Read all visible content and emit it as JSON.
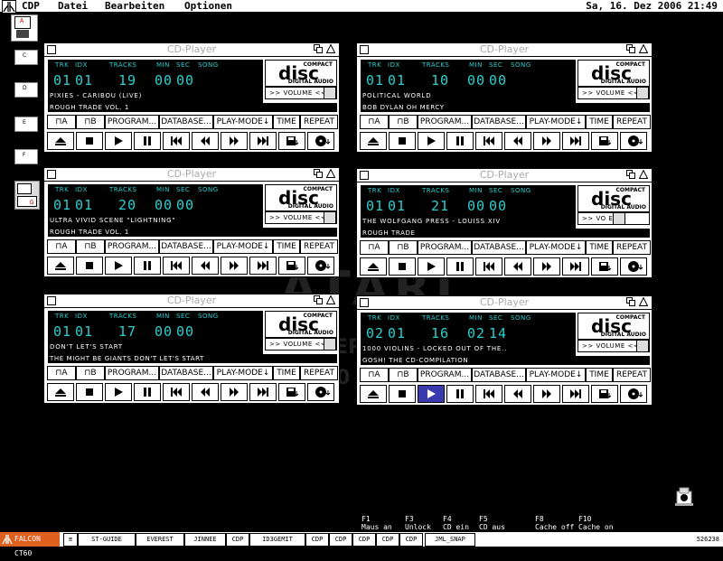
{
  "menubar": {
    "items": [
      "CDP",
      "Datei",
      "Bearbeiten",
      "Optionen"
    ],
    "clock": "Sa, 16. Dez 2006   21:49"
  },
  "desktop_icons": [
    "A",
    "C",
    "D",
    "E",
    "F",
    "G"
  ],
  "watermark": {
    "line1": "ATARI",
    "line2": "ER",
    "line3": "0"
  },
  "player_labels": {
    "title": "CD-Player",
    "hdr_trk": "TRK",
    "hdr_idx": "IDX",
    "hdr_tracks": "TRACKS",
    "hdr_min": "MIN",
    "hdr_sec": "SEC",
    "hdr_song": "SONG",
    "logo_top": "COMPACT",
    "logo_main": "disc",
    "logo_bottom": "DIGITAL AUDIO",
    "buttons": [
      "⊓A",
      "⊓B",
      "PROGRAM...",
      "DATABASE...",
      "PLAY-MODE↓",
      "TIME",
      "REPEAT"
    ]
  },
  "players": [
    {
      "trk": "01",
      "idx": "01",
      "tracks": "19",
      "min": "00",
      "sec": "00",
      "song": "PIXIES - CARIBOU (LIVE)",
      "album": "ROUGH TRADE VOL. 1",
      "volume": ">> VOLUME <<",
      "active": -1
    },
    {
      "trk": "01",
      "idx": "01",
      "tracks": "10",
      "min": "00",
      "sec": "00",
      "song": "POLITICAL WORLD",
      "album": "BOB DYLAN  OH MERCY",
      "volume": ">> VOLUME <<",
      "active": -1
    },
    {
      "trk": "01",
      "idx": "01",
      "tracks": "20",
      "min": "00",
      "sec": "00",
      "song": "ULTRA VIVID SCENE \"LIGHTNING\"",
      "album": "ROUGH TRADE  VOL. 1",
      "volume": ">> VOLUME <<",
      "active": -1
    },
    {
      "trk": "01",
      "idx": "01",
      "tracks": "21",
      "min": "00",
      "sec": "00",
      "song": "THE WOLFGANG PRESS - LOUISS XIV",
      "album": "ROUGH TRADE",
      "volume": ">> VO  E >>",
      "active": -1
    },
    {
      "trk": "01",
      "idx": "01",
      "tracks": "17",
      "min": "00",
      "sec": "00",
      "song": "DON'T LET'S START",
      "album": "THE MIGHT BE GIANTS  DON'T LET'S START",
      "volume": ">> VOLUME <<",
      "active": -1
    },
    {
      "trk": "02",
      "idx": "01",
      "tracks": "16",
      "min": "02",
      "sec": "14",
      "song": "1000 VIOLINS - LOCKED OUT OF THE..",
      "album": "GOSH! THE CD-COMPILATION",
      "volume": ">> VOLUME <<",
      "active": 2
    }
  ],
  "fhints": [
    {
      "key": "F1",
      "text": "Maus an"
    },
    {
      "key": "F3",
      "text": "Unlock"
    },
    {
      "key": "F4",
      "text": "CD ein"
    },
    {
      "key": "F5",
      "text": "CD aus"
    },
    {
      "key": "F8",
      "text": "Cache off"
    },
    {
      "key": "F10",
      "text": "Cache on"
    }
  ],
  "taskbar": {
    "start": "FALCON CT60",
    "items": [
      "≡",
      "ST-GUIDE",
      "EVEREST",
      "JINNEE",
      "CDP",
      "ID3GEMIT",
      "CDP",
      "CDP",
      "CDP",
      "CDP",
      "CDP",
      "JML_SNAP"
    ],
    "memory": "526238"
  },
  "colors": {
    "lcd": "#2ad0d0",
    "active_play": "#3a3ab0",
    "start": "#e06020"
  }
}
